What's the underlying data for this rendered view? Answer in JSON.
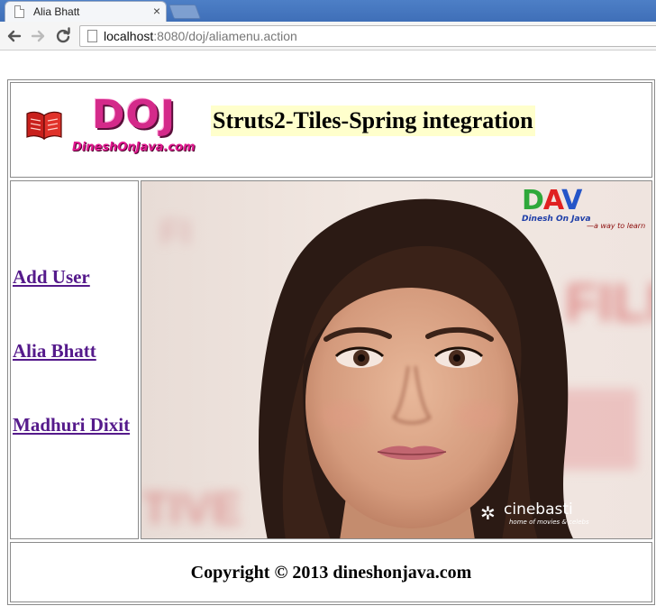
{
  "browser": {
    "tab_title": "Alia Bhatt",
    "close_glyph": "×",
    "url_host": "localhost",
    "url_rest": ":8080/doj/aliamenu.action"
  },
  "header": {
    "logo_text": "DOJ",
    "logo_subtext": "DineshOnJava.com",
    "title": "Struts2-Tiles-Spring integration"
  },
  "menu": {
    "items": [
      {
        "label": "Add User"
      },
      {
        "label": "Alia Bhatt"
      },
      {
        "label": "Madhuri Dixit"
      }
    ]
  },
  "body": {
    "dav_logo": "DAV",
    "dav_sub": "Dinesh On Java",
    "dav_tag": "—a way to learn",
    "watermark_name": "cinebasti",
    "watermark_tag": "home of movies & celebs"
  },
  "footer": {
    "copyright": "Copyright © 2013 dineshonjava.com"
  },
  "colors": {
    "link_visited": "#551a8b",
    "title_highlight": "#ffffcc",
    "logo_pink": "#d42a8a"
  }
}
